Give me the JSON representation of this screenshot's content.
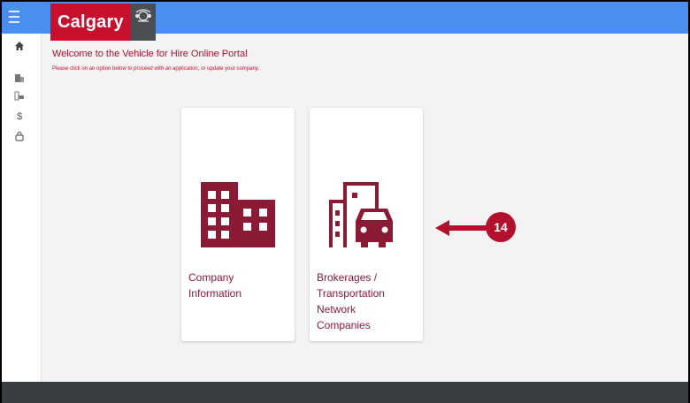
{
  "header": {
    "logo_text": "Calgary",
    "menu_icon": "hamburger-icon",
    "brand_color": "#c8102e",
    "bar_color": "#4a8ff0"
  },
  "sidebar": {
    "items": [
      {
        "icon": "home-icon"
      },
      {
        "icon": "building-icon"
      },
      {
        "icon": "city-car-icon"
      },
      {
        "icon": "dollar-icon"
      },
      {
        "icon": "lock-icon"
      }
    ]
  },
  "main": {
    "welcome": "Welcome to the Vehicle for Hire Online Portal",
    "instruction": "Please click on an option below to proceed with an application, or update your company.",
    "cards": [
      {
        "label": "Company\nInformation",
        "icon": "building-icon"
      },
      {
        "label": "Brokerages /\nTransportation\nNetwork\nCompanies",
        "icon": "city-car-icon"
      }
    ]
  },
  "callout": {
    "number": "14",
    "color": "#b2102c"
  }
}
